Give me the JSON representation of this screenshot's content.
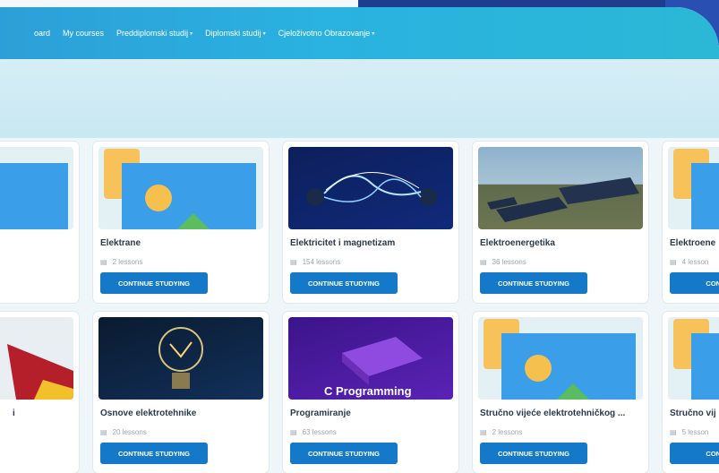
{
  "nav": {
    "items": [
      {
        "label": "oard",
        "caret": ""
      },
      {
        "label": "My courses",
        "caret": ""
      },
      {
        "label": "Preddiplomski studij",
        "caret": "▾"
      },
      {
        "label": "Diplomski studij",
        "caret": "▾"
      },
      {
        "label": "Cjeloživotno Obrazovanje",
        "caret": "▾"
      }
    ]
  },
  "courses": {
    "row1": [
      {
        "title": "",
        "lessons": "",
        "button": ""
      },
      {
        "title": "Elektrane",
        "lessons": "2 lessons",
        "button": "CONTINUE STUDYING"
      },
      {
        "title": "Elektricitet i magnetizam",
        "lessons": "154 lessons",
        "button": "CONTINUE STUDYING"
      },
      {
        "title": "Elektroenergetika",
        "lessons": "36 lessons",
        "button": "CONTINUE STUDYING"
      },
      {
        "title": "Elektroene",
        "lessons": "4 lesson",
        "button": "CONTINUE"
      }
    ],
    "row2": [
      {
        "title": "i",
        "lessons": "",
        "button": ""
      },
      {
        "title": "Osnove elektrotehnike",
        "lessons": "20 lessons",
        "button": "CONTINUE STUDYING"
      },
      {
        "title": "Programiranje",
        "lessons": "63 lessons",
        "button": "CONTINUE STUDYING"
      },
      {
        "title": "Stručno vijeće elektrotehničkog ...",
        "lessons": "2 lessons",
        "button": "CONTINUE STUDYING"
      },
      {
        "title": "Stručno vij",
        "lessons": "5 lesson",
        "button": "CONTINUE"
      }
    ]
  },
  "thumb_text": {
    "programming": "C Programming"
  },
  "icons": {
    "lessons": "book-icon",
    "caret": "chevron-down-icon"
  },
  "colors": {
    "primary": "#1479c8",
    "navbar": "#2ab2e0",
    "accent_dark": "#1f3d8f"
  }
}
